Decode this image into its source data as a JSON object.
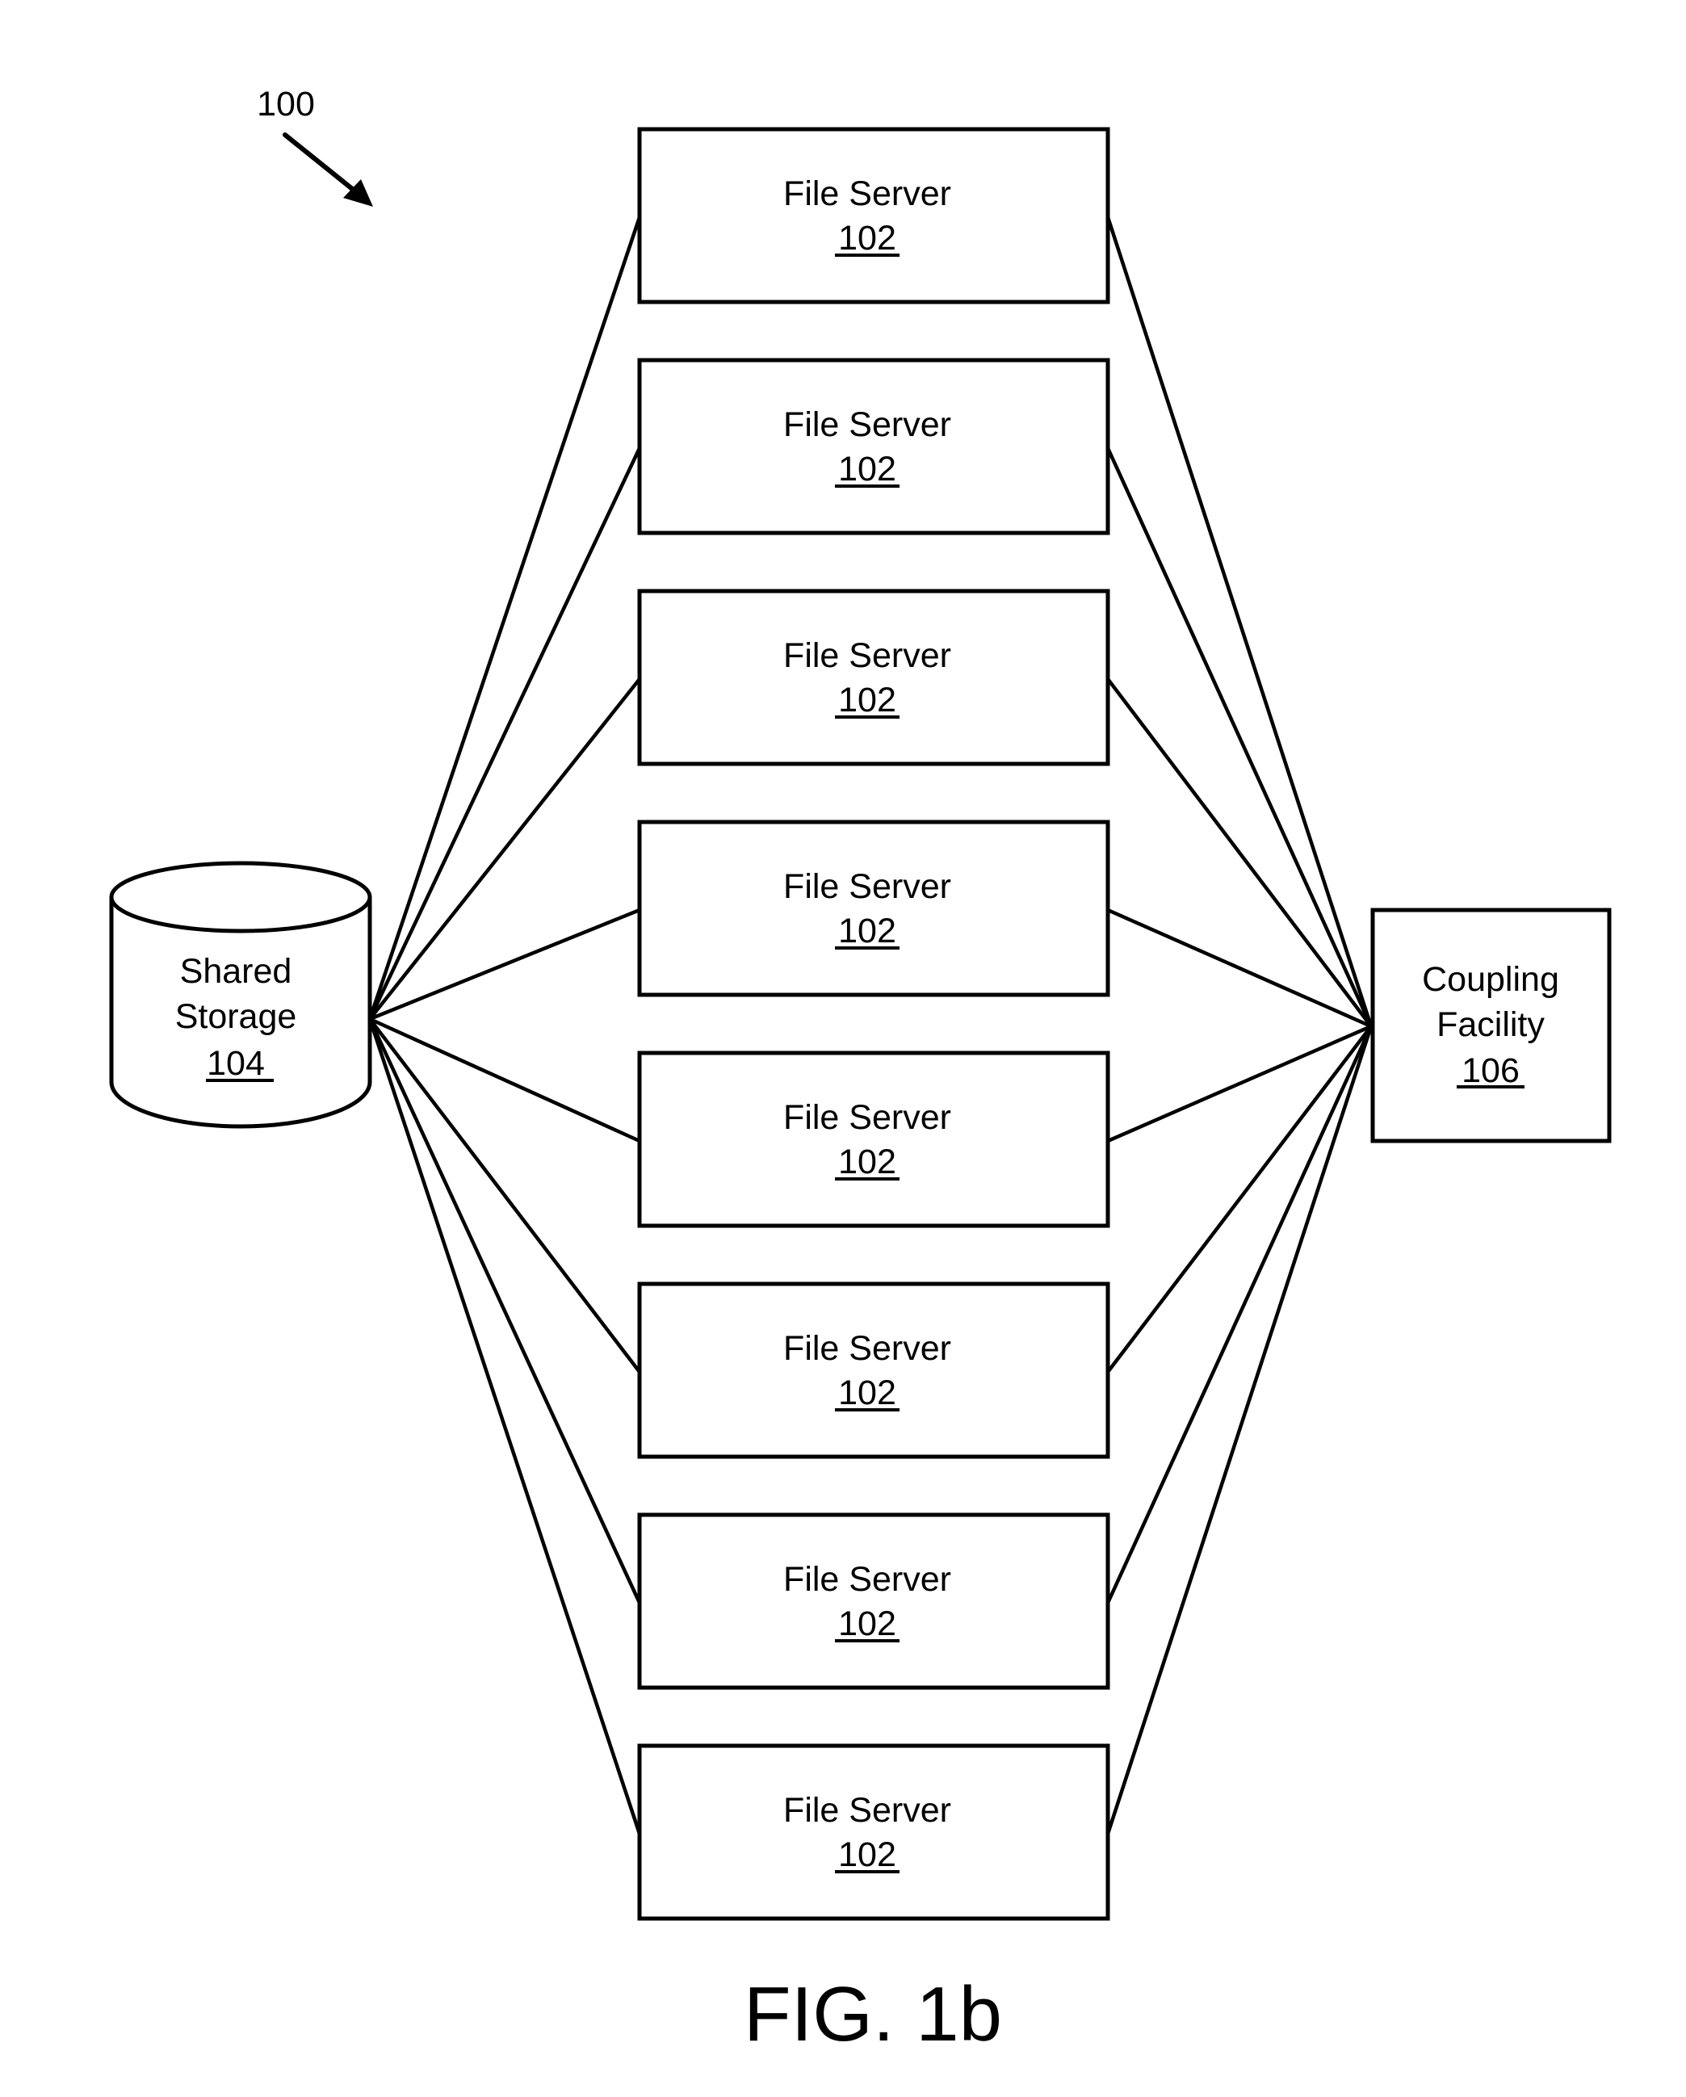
{
  "figure": {
    "reference_label": "100",
    "caption": "FIG. 1b"
  },
  "shared_storage": {
    "line1": "Shared",
    "line2": "Storage",
    "ref": "104"
  },
  "coupling_facility": {
    "line1": "Coupling",
    "line2": "Facility",
    "ref": "106"
  },
  "file_servers": [
    {
      "label": "File Server",
      "ref": "102"
    },
    {
      "label": "File Server",
      "ref": "102"
    },
    {
      "label": "File Server",
      "ref": "102"
    },
    {
      "label": "File Server",
      "ref": "102"
    },
    {
      "label": "File Server",
      "ref": "102"
    },
    {
      "label": "File Server",
      "ref": "102"
    },
    {
      "label": "File Server",
      "ref": "102"
    },
    {
      "label": "File Server",
      "ref": "102"
    }
  ],
  "connections": {
    "storage_to_each_server": true,
    "each_server_to_coupling_facility": true
  },
  "colors": {
    "ink": "#000000",
    "background": "#ffffff"
  }
}
